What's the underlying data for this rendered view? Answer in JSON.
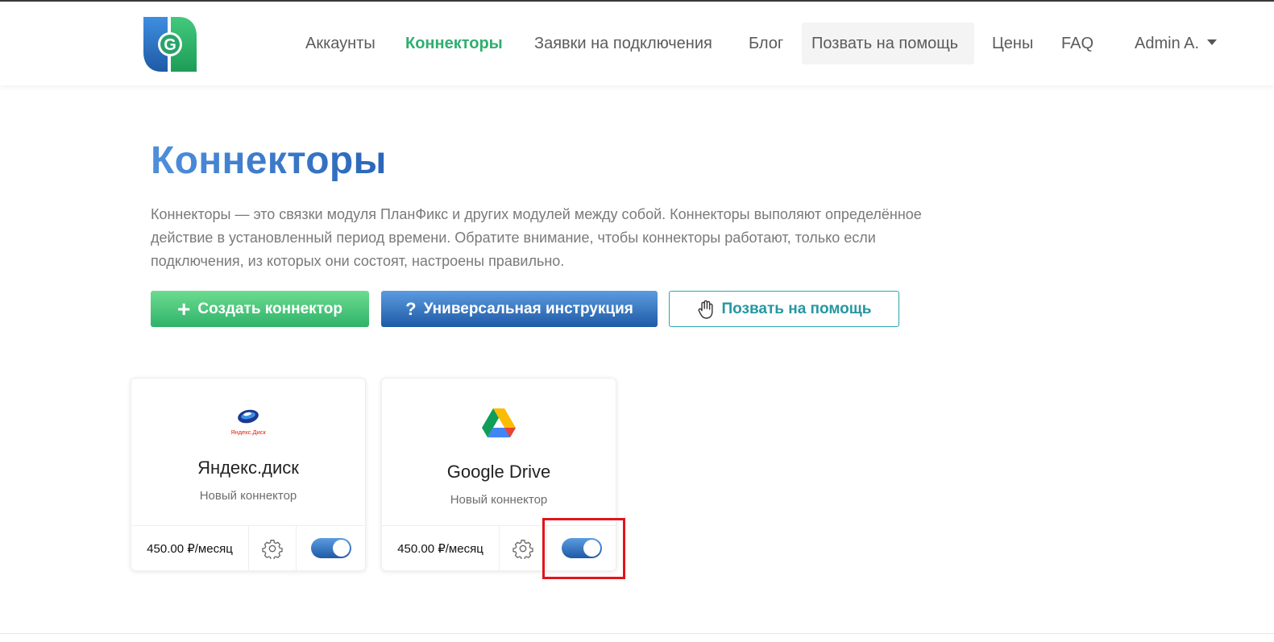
{
  "nav": {
    "items": [
      {
        "label": "Аккаунты"
      },
      {
        "label": "Коннекторы"
      },
      {
        "label": "Заявки на подключения"
      },
      {
        "label": "Блог"
      },
      {
        "label": "Позвать на помощь"
      },
      {
        "label": "Цены"
      },
      {
        "label": "FAQ"
      }
    ],
    "user": "Admin A."
  },
  "page": {
    "title": "Коннекторы",
    "description": "Коннекторы — это связки модуля ПланФикс и других модулей между собой. Коннекторы выполяют определённое действие в установленный период времени. Обратите внимание, чтобы коннекторы работают, только если подключения, из которых они состоят, настроены правильно."
  },
  "actions": {
    "create": "Создать коннектор",
    "guide": "Универсальная инструкция",
    "help": "Позвать на помощь"
  },
  "cards": [
    {
      "title": "Яндекс.диск",
      "subtitle": "Новый коннектор",
      "price": "450.00 ₽/месяц",
      "enabled": true,
      "logo_text": "Яндекс.Диск",
      "icon": "yandex-disk-icon"
    },
    {
      "title": "Google Drive",
      "subtitle": "Новый коннектор",
      "price": "450.00 ₽/месяц",
      "enabled": true,
      "icon": "google-drive-icon"
    }
  ],
  "colors": {
    "accent_green": "#2fae6f",
    "accent_blue": "#1f5aa6",
    "help_teal": "#2597a3",
    "highlight_red": "#e3131a"
  }
}
